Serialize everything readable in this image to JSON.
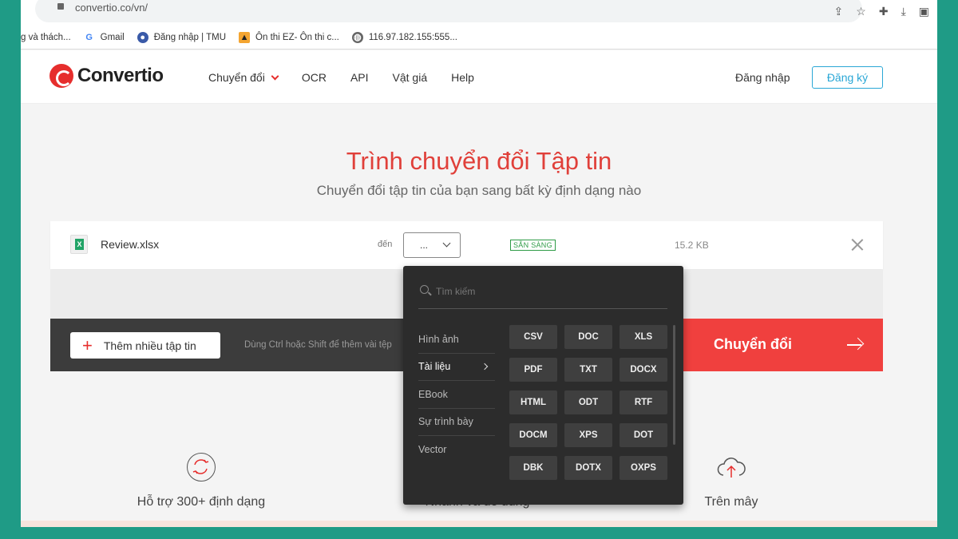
{
  "browser": {
    "url": "convertio.co/vn/",
    "bookmarks": [
      "g và thách...",
      "Gmail",
      "Đăng nhập | TMU",
      "Ôn thi EZ- Ôn thi c...",
      "116.97.182.155:555..."
    ]
  },
  "header": {
    "logo": "Convertio",
    "nav": [
      "Chuyển đổi",
      "OCR",
      "API",
      "Vật giá",
      "Help"
    ],
    "login": "Đăng nhập",
    "signup": "Đăng ký"
  },
  "hero": {
    "title": "Trình chuyển đổi Tập tin",
    "subtitle": "Chuyển đổi tập tin của bạn sang bất kỳ định dạng nào"
  },
  "file": {
    "name": "Review.xlsx",
    "to_label": "đến",
    "format_value": "...",
    "status": "SẴN SÀNG",
    "size": "15.2 KB"
  },
  "actions": {
    "add_label": "Thêm nhiều tập tin",
    "hint": "Dùng Ctrl hoặc Shift để thêm vài tệp",
    "convert_label": "Chuyển đổi"
  },
  "features": [
    {
      "label": "Hỗ trợ 300+ định dạng"
    },
    {
      "label": "Nhanh và dễ dùng"
    },
    {
      "label": "Trên mây"
    }
  ],
  "dropdown": {
    "search_placeholder": "Tìm kiếm",
    "categories": [
      "Hình ảnh",
      "Tài liệu",
      "EBook",
      "Sự trình bày",
      "Vector"
    ],
    "active_category": "Tài liệu",
    "formats": [
      "CSV",
      "DOC",
      "XLS",
      "PDF",
      "TXT",
      "DOCX",
      "HTML",
      "ODT",
      "RTF",
      "DOCM",
      "XPS",
      "DOT",
      "DBK",
      "DOTX",
      "OXPS"
    ]
  },
  "colors": {
    "brand_red": "#e62e2d",
    "accent_blue": "#2aa7d6",
    "ready_green": "#2e9b46",
    "background_teal": "#1f9b86"
  }
}
